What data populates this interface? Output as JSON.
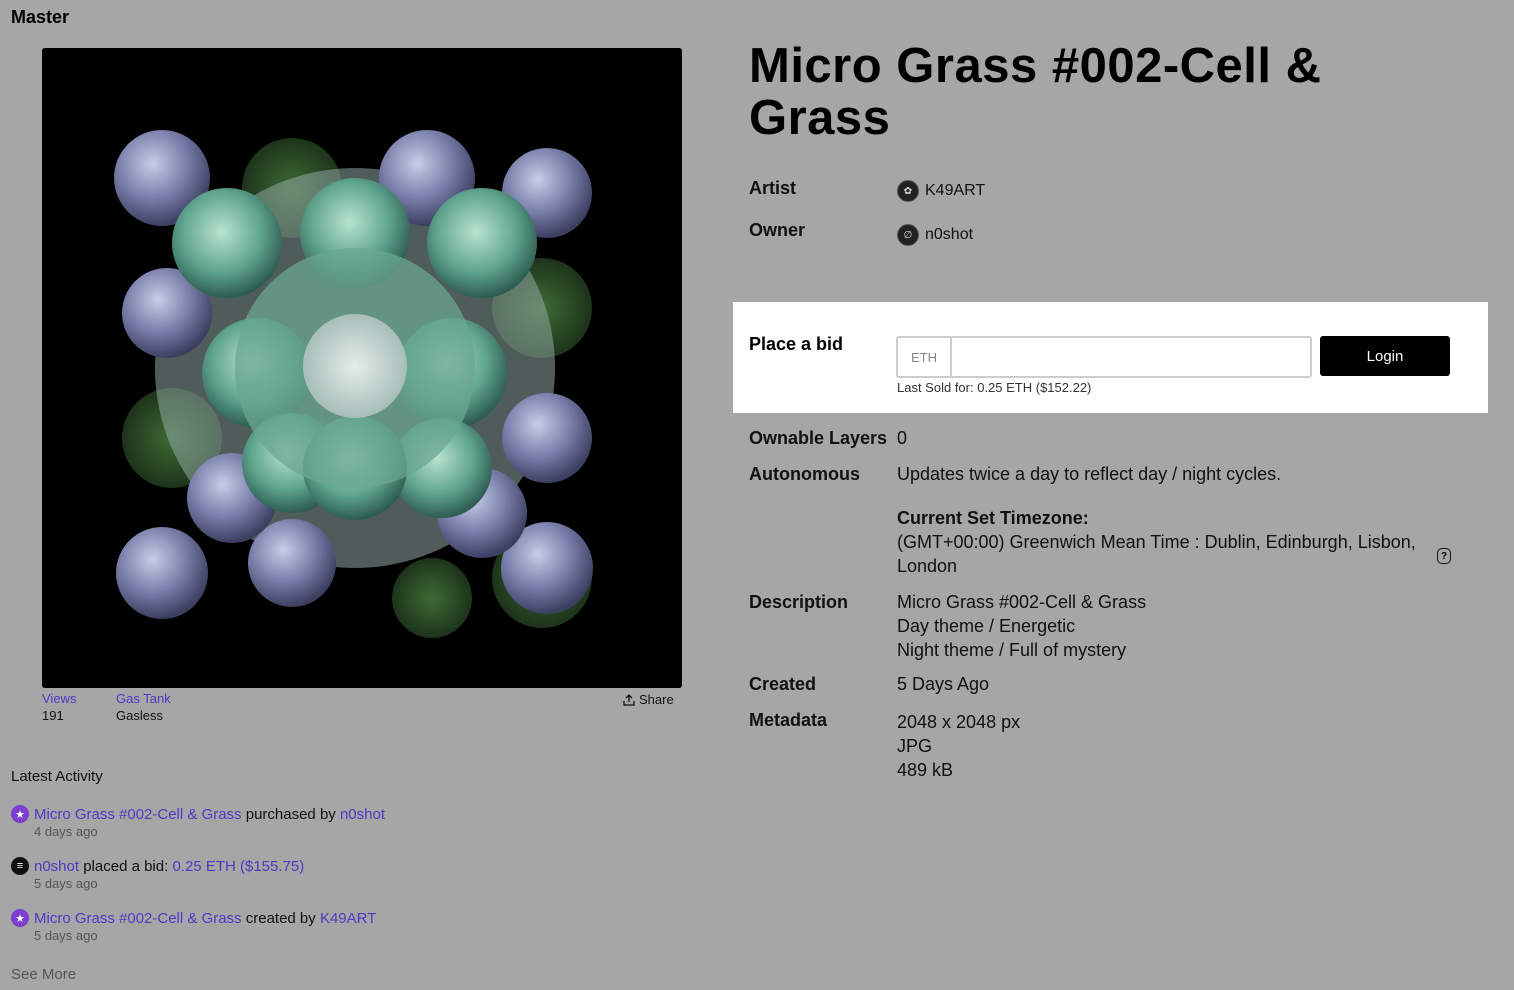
{
  "header": {
    "master_label": "Master"
  },
  "stats": {
    "views_label": "Views",
    "views_value": "191",
    "gas_label": "Gas Tank",
    "gas_value": "Gasless",
    "share_label": "Share"
  },
  "activity": {
    "title": "Latest Activity",
    "items": [
      {
        "icon": "star-icon",
        "subject": "Micro Grass #002-Cell & Grass",
        "verb": " purchased by ",
        "object": "n0shot",
        "time": "4 days ago"
      },
      {
        "icon": "bid-icon",
        "subject": "n0shot",
        "verb": " placed a bid: ",
        "object": "0.25 ETH ($155.75)",
        "time": "5 days ago"
      },
      {
        "icon": "star-icon",
        "subject": "Micro Grass #002-Cell & Grass",
        "verb": " created by ",
        "object": "K49ART",
        "time": "5 days ago"
      }
    ],
    "see_more": "See More"
  },
  "artwork": {
    "title": "Micro Grass #002-Cell & Grass",
    "artist_label": "Artist",
    "artist_name": "K49ART",
    "owner_label": "Owner",
    "owner_name": "n0shot"
  },
  "bid": {
    "label": "Place a bid",
    "currency": "ETH",
    "input_value": "",
    "login_label": "Login",
    "last_sold": "Last Sold for: 0.25 ETH ($152.22)"
  },
  "details": {
    "ownable_label": "Ownable Layers",
    "ownable_value": "0",
    "autonomous_label": "Autonomous",
    "autonomous_value": "Updates twice a day to reflect day / night cycles.",
    "timezone_label": "Current Set Timezone:",
    "timezone_value_1": "(GMT+00:00) Greenwich Mean Time : Dublin, Edinburgh, Lisbon,",
    "timezone_value_2": "London",
    "help_glyph": "?",
    "description_label": "Description",
    "description_lines": [
      "Micro Grass #002-Cell & Grass",
      "Day theme / Energetic",
      "Night theme / Full of mystery"
    ],
    "created_label": "Created",
    "created_value": "5 Days Ago",
    "metadata_label": "Metadata",
    "metadata_lines": [
      "2048 x 2048 px",
      "JPG",
      "489 kB"
    ]
  },
  "colors": {
    "background": "#a6a6a6",
    "link": "#5237c4",
    "accent_star": "#7a3fcf"
  }
}
